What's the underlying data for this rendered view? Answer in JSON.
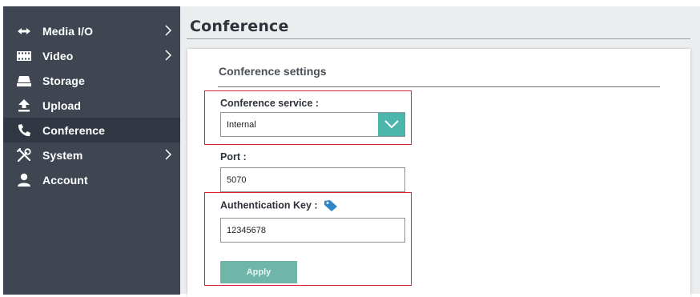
{
  "sidebar": {
    "items": [
      {
        "label": "Media I/O",
        "icon": "media-io-arrows-icon",
        "has_chevron": true
      },
      {
        "label": "Video",
        "icon": "film-strip-icon",
        "has_chevron": true
      },
      {
        "label": "Storage",
        "icon": "storage-drive-icon",
        "has_chevron": false
      },
      {
        "label": "Upload",
        "icon": "upload-arrow-icon",
        "has_chevron": false
      },
      {
        "label": "Conference",
        "icon": "phone-handset-icon",
        "has_chevron": false,
        "active": true
      },
      {
        "label": "System",
        "icon": "tools-icon",
        "has_chevron": true
      },
      {
        "label": "Account",
        "icon": "user-icon",
        "has_chevron": false
      }
    ]
  },
  "main": {
    "title": "Conference",
    "section_title": "Conference settings",
    "conference_service": {
      "label": "Conference service :",
      "value": "Internal"
    },
    "port": {
      "label": "Port :",
      "value": "5070"
    },
    "auth_key": {
      "label": "Authentication Key :",
      "value": "12345678"
    },
    "apply_label": "Apply"
  },
  "colors": {
    "sidebar_bg": "#3f4652",
    "sidebar_active": "#323843",
    "accent_teal": "#4db6ac",
    "apply_button": "#6fb5a8",
    "tag_icon": "#2f86c9",
    "highlight_red": "#d9222a"
  }
}
